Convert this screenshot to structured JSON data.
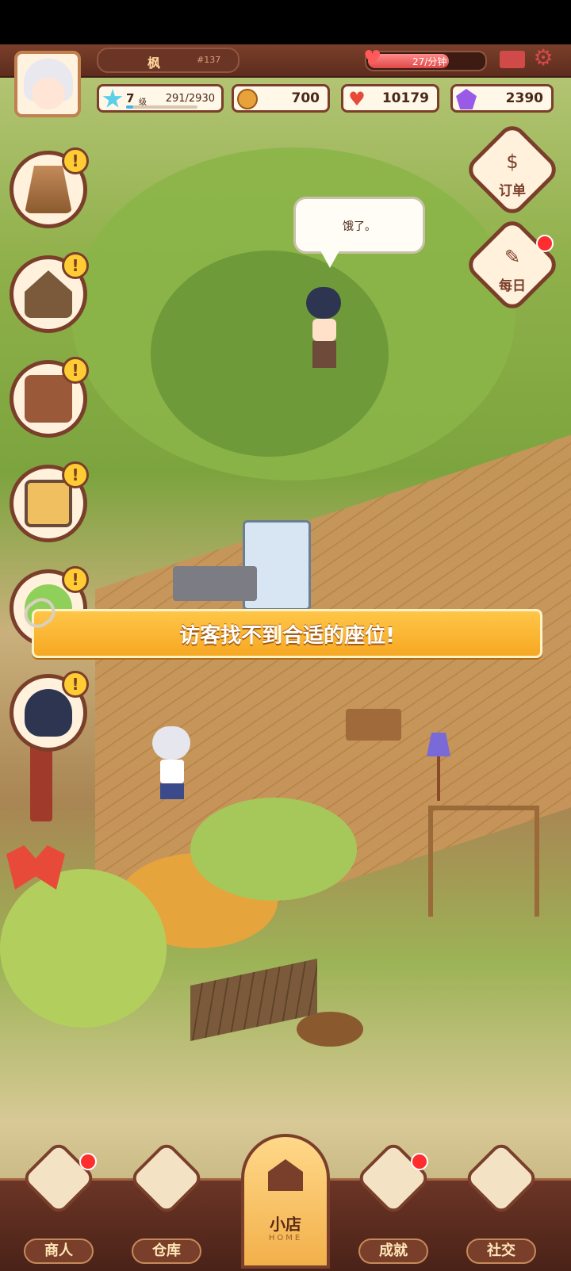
{
  "player": {
    "name": "枫",
    "id": "#137",
    "level": "7",
    "level_unit": "级",
    "xp": "291/2930",
    "xp_fraction": 0.099
  },
  "energy": {
    "text": "27/分钟",
    "fill_fraction": 0.7
  },
  "resources": {
    "coins": "700",
    "hearts": "10179",
    "gems": "2390"
  },
  "right_buttons": {
    "orders_label": "订单",
    "daily_label": "每日"
  },
  "speech_bubble": {
    "text": "饿了。"
  },
  "notice_banner": {
    "text": "访客找不到合适的座位!"
  },
  "quest_buttons": [
    {
      "icon": "swing-frame-icon"
    },
    {
      "icon": "doghouse-icon"
    },
    {
      "icon": "cash-register-icon"
    },
    {
      "icon": "tv-icon"
    },
    {
      "icon": "cabbage-icon"
    },
    {
      "icon": "boy-avatar-icon"
    }
  ],
  "bottom_nav": {
    "merchant": "商人",
    "warehouse": "仓库",
    "shop": "小店",
    "shop_sub": "HOME",
    "achievements": "成就",
    "social": "社交"
  },
  "colors": {
    "hud_brown": "#7a3f2a",
    "banner_orange": "#f6a823",
    "notice_red": "#ff2d2d",
    "alert_yellow": "#ffcc33"
  }
}
